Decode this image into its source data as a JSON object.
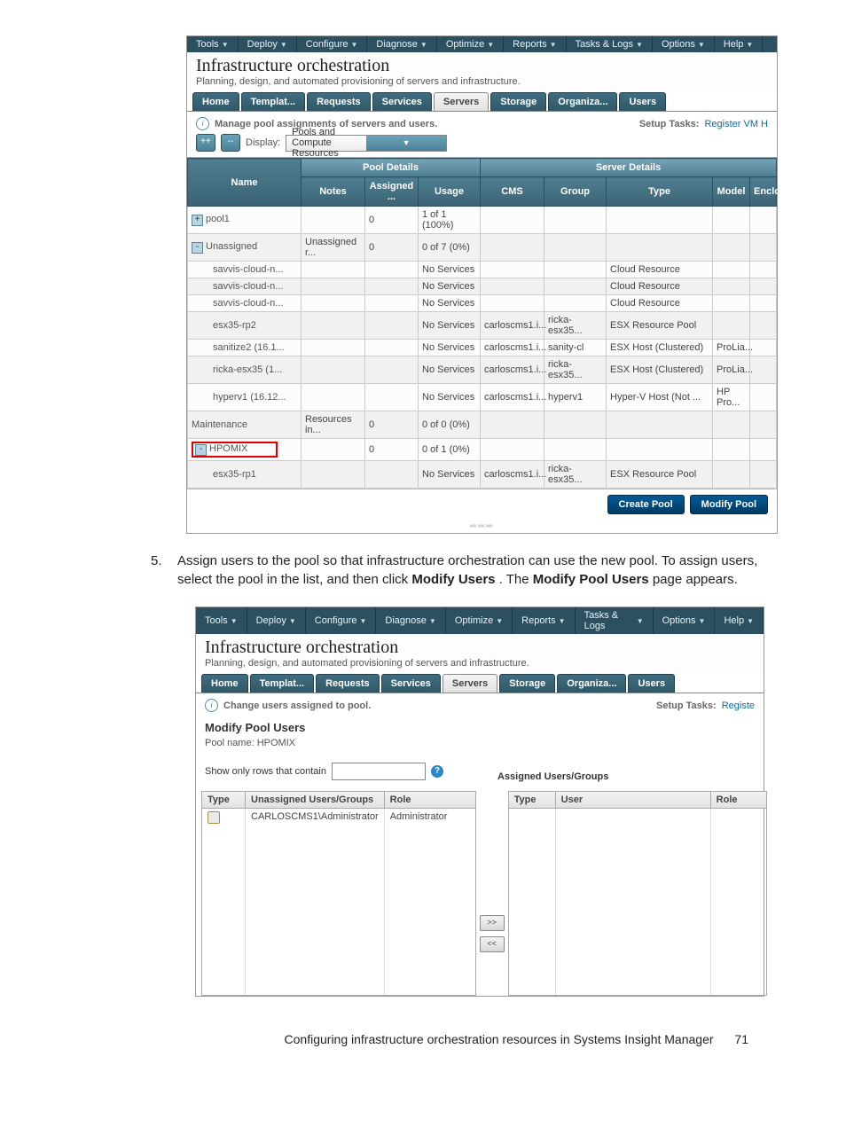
{
  "menus": [
    "Tools",
    "Deploy",
    "Configure",
    "Diagnose",
    "Optimize",
    "Reports",
    "Tasks & Logs",
    "Options",
    "Help"
  ],
  "header": {
    "title": "Infrastructure orchestration",
    "sub": "Planning, design, and automated provisioning of servers and infrastructure."
  },
  "tabs1": [
    "Home",
    "Templat...",
    "Requests",
    "Services",
    "Servers",
    "Storage",
    "Organiza...",
    "Users"
  ],
  "tabs1_selected": 4,
  "info1": {
    "msg": "Manage pool assignments of servers and users.",
    "setup": "Setup Tasks:",
    "link": "Register VM H"
  },
  "toolbar": {
    "display_label": "Display:",
    "select_value": "Pools and Compute Resources"
  },
  "section_heads": {
    "pool": "Pool Details",
    "server": "Server Details"
  },
  "cols": {
    "name": "Name",
    "notes": "Notes",
    "assigned": "Assigned ...",
    "usage": "Usage",
    "cms": "CMS",
    "group": "Group",
    "type": "Type",
    "model": "Model",
    "enclosure": "Enclosur"
  },
  "rows": [
    {
      "exp": "+",
      "name": "pool1",
      "notes": "",
      "assigned": "0",
      "usage": "1 of 1 (100%)",
      "cms": "",
      "group": "",
      "type": "",
      "model": "",
      "encl": "",
      "alt": false
    },
    {
      "exp": "-",
      "name": "Unassigned",
      "notes": "Unassigned r...",
      "assigned": "0",
      "usage": "0 of 7 (0%)",
      "cms": "",
      "group": "",
      "type": "",
      "model": "",
      "encl": "",
      "alt": true
    },
    {
      "exp": "",
      "name": "savvis-cloud-n...",
      "notes": "",
      "assigned": "",
      "usage": "No Services",
      "cms": "",
      "group": "",
      "type": "Cloud Resource",
      "model": "",
      "encl": "",
      "indent": true,
      "alt": false
    },
    {
      "exp": "",
      "name": "savvis-cloud-n...",
      "notes": "",
      "assigned": "",
      "usage": "No Services",
      "cms": "",
      "group": "",
      "type": "Cloud Resource",
      "model": "",
      "encl": "",
      "indent": true,
      "alt": true
    },
    {
      "exp": "",
      "name": "savvis-cloud-n...",
      "notes": "",
      "assigned": "",
      "usage": "No Services",
      "cms": "",
      "group": "",
      "type": "Cloud Resource",
      "model": "",
      "encl": "",
      "indent": true,
      "alt": false
    },
    {
      "exp": "",
      "name": "esx35-rp2",
      "notes": "",
      "assigned": "",
      "usage": "No Services",
      "cms": "carloscms1.i...",
      "group": "ricka-esx35...",
      "type": "ESX Resource Pool",
      "model": "",
      "encl": "",
      "indent": true,
      "alt": true
    },
    {
      "exp": "",
      "name": "sanitize2 (16.1...",
      "notes": "",
      "assigned": "",
      "usage": "No Services",
      "cms": "carloscms1.i...",
      "group": "sanity-cl",
      "type": "ESX Host (Clustered)",
      "model": "ProLia...",
      "encl": "",
      "indent": true,
      "alt": false
    },
    {
      "exp": "",
      "name": "ricka-esx35 (1...",
      "notes": "",
      "assigned": "",
      "usage": "No Services",
      "cms": "carloscms1.i...",
      "group": "ricka-esx35...",
      "type": "ESX Host (Clustered)",
      "model": "ProLia...",
      "encl": "",
      "indent": true,
      "alt": true
    },
    {
      "exp": "",
      "name": "hyperv1 (16.12...",
      "notes": "",
      "assigned": "",
      "usage": "No Services",
      "cms": "carloscms1.i...",
      "group": "hyperv1",
      "type": "Hyper-V Host (Not ...",
      "model": "HP Pro...",
      "encl": "",
      "indent": true,
      "alt": false
    },
    {
      "exp": "",
      "name": "Maintenance",
      "notes": "Resources in...",
      "assigned": "0",
      "usage": "0 of 0 (0%)",
      "cms": "",
      "group": "",
      "type": "",
      "model": "",
      "encl": "",
      "alt": true
    },
    {
      "exp": "-",
      "name": "HPOMIX",
      "notes": "",
      "assigned": "0",
      "usage": "0 of 1 (0%)",
      "cms": "",
      "group": "",
      "type": "",
      "model": "",
      "encl": "",
      "alt": false,
      "red": true
    },
    {
      "exp": "",
      "name": "esx35-rp1",
      "notes": "",
      "assigned": "",
      "usage": "No Services",
      "cms": "carloscms1.i...",
      "group": "ricka-esx35...",
      "type": "ESX Resource Pool",
      "model": "",
      "encl": "",
      "indent": true,
      "alt": true
    }
  ],
  "buttons1": {
    "create": "Create Pool",
    "modify": "Modify Pool"
  },
  "step": {
    "num": "5.",
    "text_a": "Assign users to the pool so that infrastructure orchestration can use the new pool. To assign users, select the pool in the list, and then click ",
    "b1": "Modify Users",
    "text_b": ". The ",
    "b2": "Modify Pool Users",
    "text_c": " page appears."
  },
  "tabs2": [
    "Home",
    "Templat...",
    "Requests",
    "Services",
    "Servers",
    "Storage",
    "Organiza...",
    "Users"
  ],
  "tabs2_selected": 4,
  "info2": {
    "msg": "Change users assigned to pool.",
    "setup": "Setup Tasks:",
    "link": "Registe"
  },
  "modify": {
    "title": "Modify Pool Users",
    "poolname": "Pool name: HPOMIX",
    "filter_label": "Show only rows that contain",
    "assigned_title": "Assigned Users/Groups"
  },
  "panelL": {
    "c1": "Type",
    "c2": "Unassigned Users/Groups",
    "c3": "Role",
    "row_user": "CARLOSCMS1\\Administrator",
    "row_role": "Administrator"
  },
  "panelR": {
    "c1": "Type",
    "c2": "User",
    "c3": "Role"
  },
  "move": {
    "r": ">>",
    "l": "<<"
  },
  "footer": {
    "text": "Configuring infrastructure orchestration resources in Systems Insight Manager",
    "page": "71"
  }
}
